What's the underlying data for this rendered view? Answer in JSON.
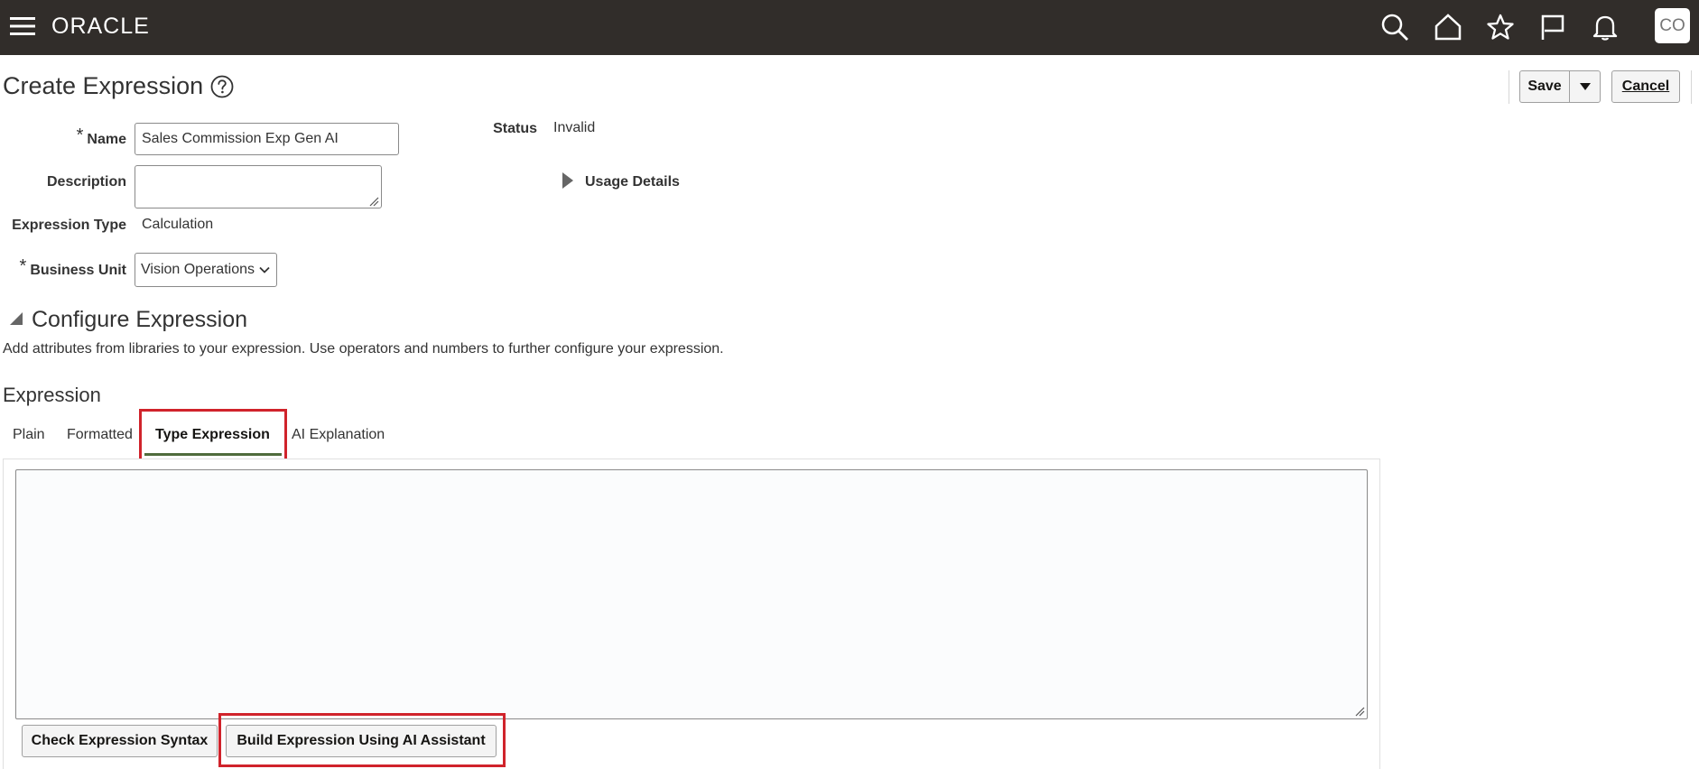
{
  "header": {
    "logo": "ORACLE",
    "avatar_initials": "CO",
    "icons": [
      "menu-icon",
      "search-icon",
      "home-icon",
      "favorites-star-icon",
      "flag-icon",
      "notifications-bell-icon"
    ]
  },
  "page": {
    "title": "Create Expression",
    "save_label": "Save",
    "cancel_label": "Cancel"
  },
  "form": {
    "name_label": "Name",
    "name_value": "Sales Commission Exp Gen AI",
    "description_label": "Description",
    "description_value": "",
    "expression_type_label": "Expression Type",
    "expression_type_value": "Calculation",
    "business_unit_label": "Business Unit",
    "business_unit_value": "Vision Operations",
    "status_label": "Status",
    "status_value": "Invalid",
    "usage_details_label": "Usage Details"
  },
  "configure": {
    "title": "Configure Expression",
    "help_text": "Add attributes from libraries to your expression. Use operators and numbers to further configure your expression."
  },
  "expression": {
    "title": "Expression",
    "tabs": [
      {
        "label": "Plain",
        "active": false
      },
      {
        "label": "Formatted",
        "active": false
      },
      {
        "label": "Type Expression",
        "active": true
      },
      {
        "label": "AI Explanation",
        "active": false
      }
    ],
    "text": "",
    "check_syntax_label": "Check Expression Syntax",
    "ai_assistant_label": "Build Expression Using AI Assistant"
  },
  "colors": {
    "topbar": "#312d2a",
    "highlight": "#d0232b",
    "active_tab_underline": "#4f6b3c"
  }
}
